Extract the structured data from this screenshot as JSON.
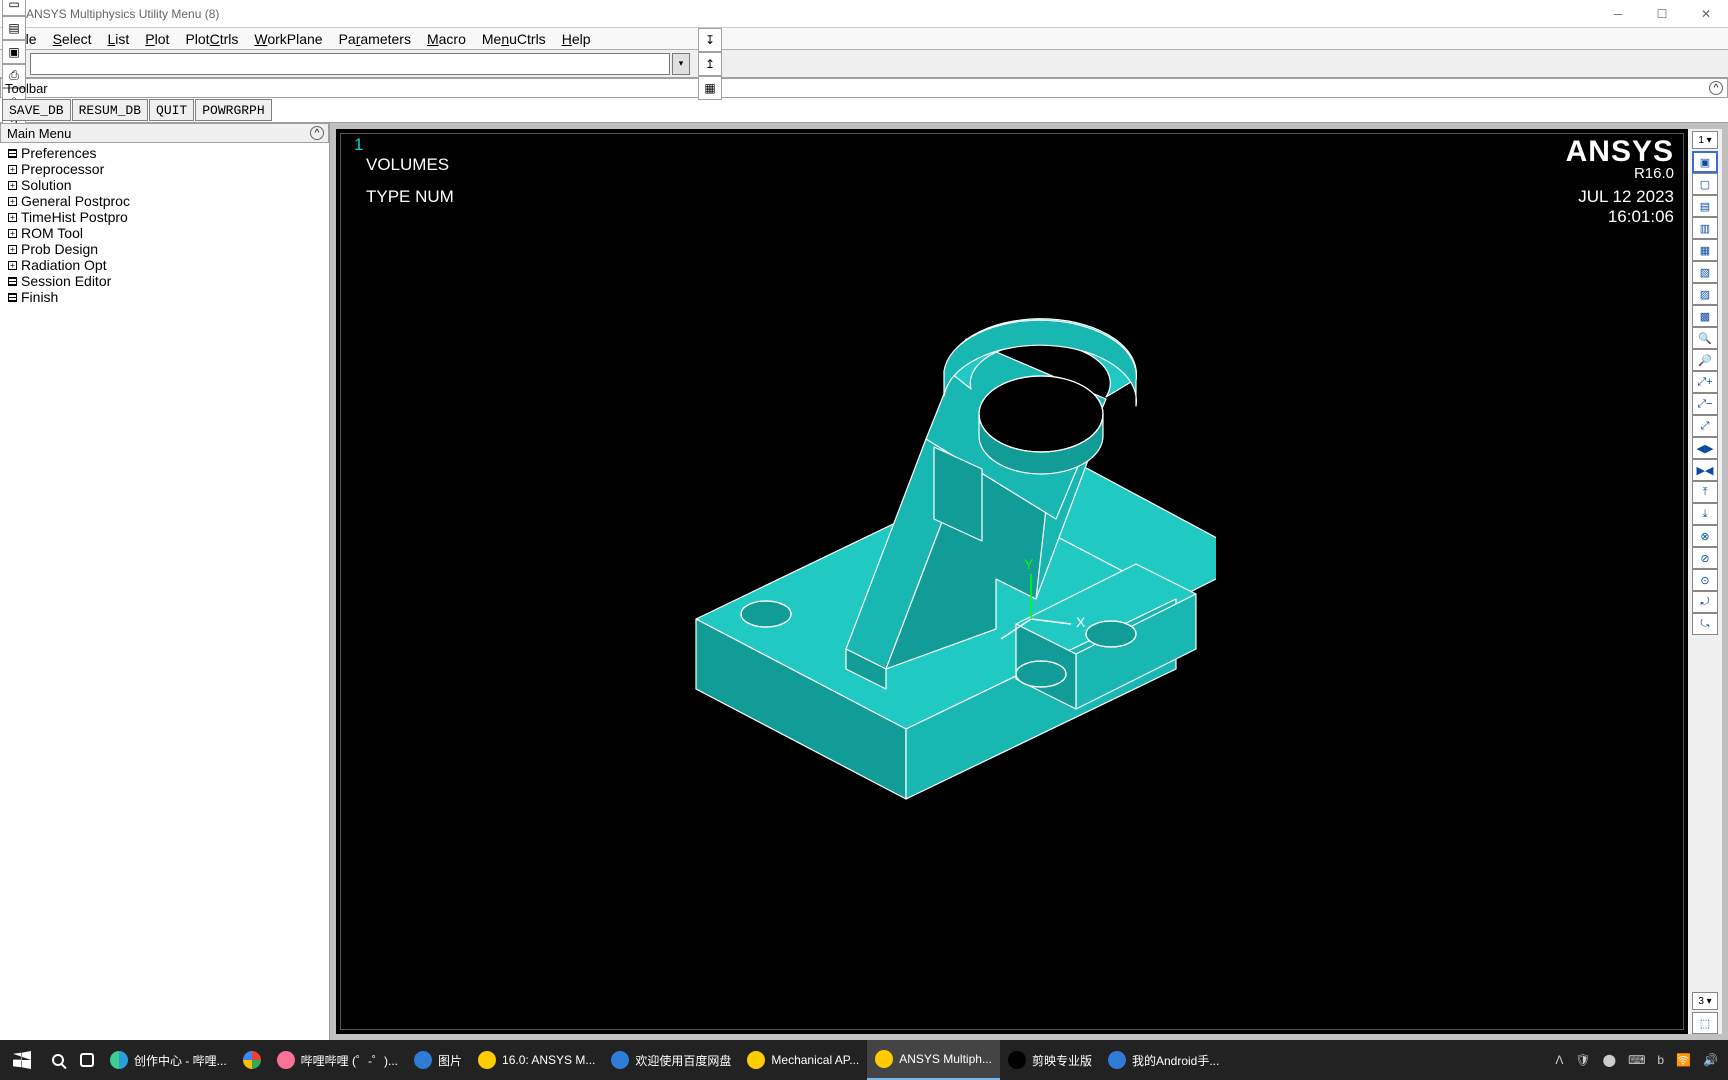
{
  "titlebar": {
    "title": "ANSYS Multiphysics Utility Menu (8)"
  },
  "menubar": {
    "items": [
      {
        "pre": "",
        "u": "F",
        "post": "ile"
      },
      {
        "pre": "",
        "u": "S",
        "post": "elect"
      },
      {
        "pre": "",
        "u": "L",
        "post": "ist"
      },
      {
        "pre": "",
        "u": "P",
        "post": "lot"
      },
      {
        "pre": "Plot",
        "u": "C",
        "post": "trls"
      },
      {
        "pre": "",
        "u": "W",
        "post": "orkPlane"
      },
      {
        "pre": "Pa",
        "u": "r",
        "post": "ameters"
      },
      {
        "pre": "",
        "u": "M",
        "post": "acro"
      },
      {
        "pre": "Me",
        "u": "n",
        "post": "uCtrls"
      },
      {
        "pre": "",
        "u": "H",
        "post": "elp"
      }
    ]
  },
  "toolbar_icons": [
    "□",
    "▭",
    "▤",
    "▣",
    "⎙",
    "⌕",
    "?",
    "▦"
  ],
  "toolbar_icons_right": [
    "↧",
    "↥",
    "▦"
  ],
  "toolbar_label": "Toolbar",
  "text_buttons": [
    "SAVE_DB",
    "RESUM_DB",
    "QUIT",
    "POWRGRPH"
  ],
  "mainmenu": {
    "title": "Main Menu",
    "items": [
      {
        "icon": "grid",
        "label": "Preferences"
      },
      {
        "icon": "plus",
        "label": "Preprocessor"
      },
      {
        "icon": "plus",
        "label": "Solution"
      },
      {
        "icon": "plus",
        "label": "General Postproc"
      },
      {
        "icon": "plus",
        "label": "TimeHist Postpro"
      },
      {
        "icon": "plus",
        "label": "ROM Tool"
      },
      {
        "icon": "plus",
        "label": "Prob Design"
      },
      {
        "icon": "plus",
        "label": "Radiation Opt"
      },
      {
        "icon": "grid",
        "label": "Session Editor"
      },
      {
        "icon": "grid",
        "label": "Finish"
      }
    ]
  },
  "graphics": {
    "window_num": "1",
    "label1": "VOLUMES",
    "label2": "TYPE NUM",
    "brand": "ANSYS",
    "version": "R16.0",
    "date": "JUL 12 2023",
    "time": "16:01:06",
    "axes": {
      "x": "X",
      "y": "Y"
    }
  },
  "rightcol": {
    "top_selector": "1 ▾",
    "icons": [
      "▣",
      "▢",
      "▤",
      "▥",
      "▦",
      "▧",
      "▨",
      "▩",
      "🔍",
      "🔎",
      "⤢+",
      "⤢−",
      "⤢",
      "◀▶",
      "▶◀",
      "⤒",
      "⤓",
      "⊗",
      "⊘",
      "⊙",
      "⤾",
      "⤿"
    ],
    "bottom_selector": "3 ▾",
    "picker": "⬚"
  },
  "taskbar": {
    "items": [
      {
        "icon": "edge",
        "color": "#29a0da,#3ccf91",
        "label": "创作中心 - 哔哩..."
      },
      {
        "icon": "chrome",
        "color": "#ea4335,#34a853,#fbbc05,#4285f4",
        "label": ""
      },
      {
        "icon": "bili",
        "color": "#fb7299",
        "label": "哔哩哔哩 (゜-゜)..."
      },
      {
        "icon": "img",
        "color": "#2e7cd6",
        "label": "图片"
      },
      {
        "icon": "ansys",
        "color": "#ffcc00",
        "label": "16.0: ANSYS M..."
      },
      {
        "icon": "baidu",
        "color": "#2e7cd6",
        "label": "欢迎使用百度网盘"
      },
      {
        "icon": "ansys",
        "color": "#ffcc00",
        "label": "Mechanical AP..."
      },
      {
        "icon": "ansys",
        "color": "#ffcc00",
        "label": "ANSYS Multiph..."
      },
      {
        "icon": "capcut",
        "color": "#000000",
        "label": "剪映专业版"
      },
      {
        "icon": "phone",
        "color": "#2e7cd6",
        "label": "我的Android手..."
      }
    ],
    "tray": [
      "Ʌ",
      "🛡",
      "⬤",
      "⌨",
      "b",
      "🛜",
      "🔊"
    ],
    "active_index": 7
  }
}
